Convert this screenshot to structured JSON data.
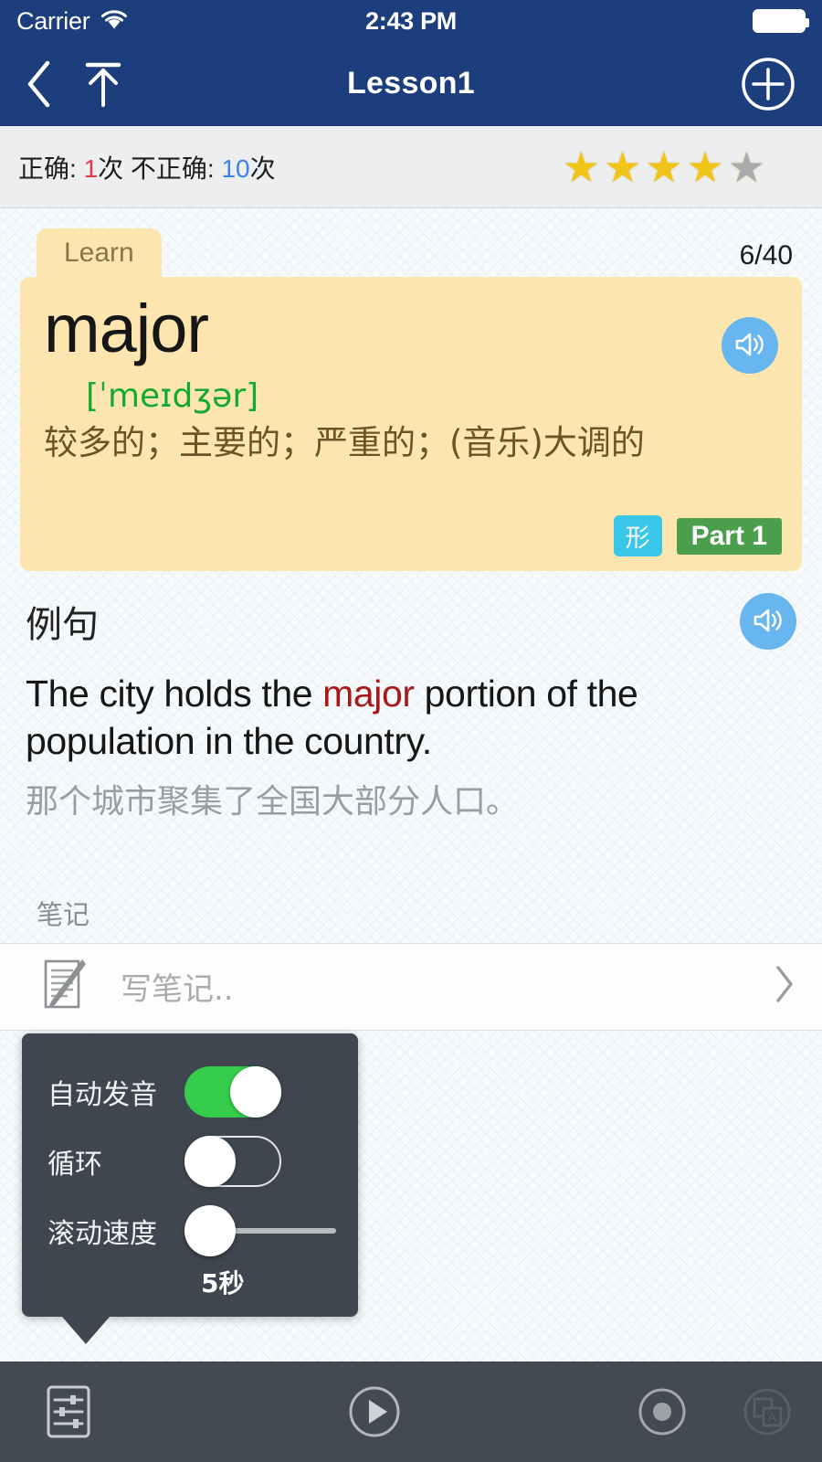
{
  "status_bar": {
    "carrier": "Carrier",
    "wifi_icon": "wifi-icon",
    "time": "2:43 PM",
    "battery_icon": "battery-full-icon"
  },
  "nav_bar": {
    "back_icon": "chevron-left-icon",
    "top_icon": "arrow-to-top-icon",
    "title": "Lesson1",
    "add_icon": "circle-plus-icon"
  },
  "stats": {
    "correct_label": "正确: ",
    "correct_count": "1",
    "correct_unit": "次 ",
    "wrong_label": "不正确: ",
    "wrong_count": "10",
    "wrong_unit": "次",
    "stars_filled": 4,
    "stars_total": 5,
    "star_glyph": "★",
    "star_color": "#f0c419",
    "star_empty_color": "#a8aaac"
  },
  "card": {
    "tab_label": "Learn",
    "counter": "6/40",
    "word": "major",
    "phonetic": "[ˈmeɪdʒər]",
    "definition": "较多的；主要的；严重的；(音乐)大调的",
    "pos_tag": "形",
    "part_tag": "Part 1",
    "speaker_icon": "speaker-icon",
    "bg_color": "#fde5b0",
    "pos_tag_color": "#38c6ea",
    "part_tag_color": "#4a9e4c"
  },
  "example": {
    "label": "例句",
    "speaker_icon": "speaker-icon",
    "sentence_before": "The city holds the ",
    "sentence_highlight": "major",
    "sentence_after": " portion of the population in the country.",
    "translation": "那个城市聚集了全国大部分人口。",
    "highlight_color": "#a81818"
  },
  "notes": {
    "label": "笔记",
    "note_icon": "note-pencil-icon",
    "placeholder": "写笔记..",
    "chevron_icon": "chevron-right-icon"
  },
  "settings_popup": {
    "rows": [
      {
        "label": "自动发音",
        "control": "toggle",
        "state": "on"
      },
      {
        "label": "循环",
        "control": "toggle",
        "state": "off"
      },
      {
        "label": "滚动速度",
        "control": "slider",
        "value": "5秒"
      }
    ],
    "speed_value": "5秒",
    "toggle_on_color": "#35cd4b",
    "bg_color": "#3f4650"
  },
  "toolbar": {
    "settings_icon": "sliders-settings-icon",
    "play_icon": "play-icon",
    "record_icon": "record-circle-icon",
    "flip_icon": "card-flip-translate-icon",
    "bg_color": "#434a54"
  }
}
